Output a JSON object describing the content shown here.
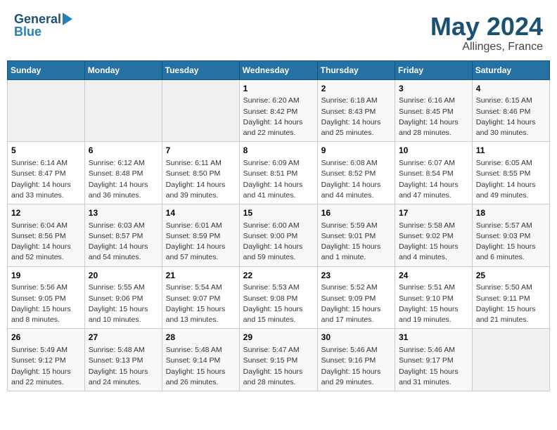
{
  "header": {
    "logo_line1": "General",
    "logo_line2": "Blue",
    "month": "May 2024",
    "location": "Allinges, France"
  },
  "days_of_week": [
    "Sunday",
    "Monday",
    "Tuesday",
    "Wednesday",
    "Thursday",
    "Friday",
    "Saturday"
  ],
  "weeks": [
    [
      {
        "day": "",
        "sunrise": "",
        "sunset": "",
        "daylight": ""
      },
      {
        "day": "",
        "sunrise": "",
        "sunset": "",
        "daylight": ""
      },
      {
        "day": "",
        "sunrise": "",
        "sunset": "",
        "daylight": ""
      },
      {
        "day": "1",
        "sunrise": "Sunrise: 6:20 AM",
        "sunset": "Sunset: 8:42 PM",
        "daylight": "Daylight: 14 hours and 22 minutes."
      },
      {
        "day": "2",
        "sunrise": "Sunrise: 6:18 AM",
        "sunset": "Sunset: 8:43 PM",
        "daylight": "Daylight: 14 hours and 25 minutes."
      },
      {
        "day": "3",
        "sunrise": "Sunrise: 6:16 AM",
        "sunset": "Sunset: 8:45 PM",
        "daylight": "Daylight: 14 hours and 28 minutes."
      },
      {
        "day": "4",
        "sunrise": "Sunrise: 6:15 AM",
        "sunset": "Sunset: 8:46 PM",
        "daylight": "Daylight: 14 hours and 30 minutes."
      }
    ],
    [
      {
        "day": "5",
        "sunrise": "Sunrise: 6:14 AM",
        "sunset": "Sunset: 8:47 PM",
        "daylight": "Daylight: 14 hours and 33 minutes."
      },
      {
        "day": "6",
        "sunrise": "Sunrise: 6:12 AM",
        "sunset": "Sunset: 8:48 PM",
        "daylight": "Daylight: 14 hours and 36 minutes."
      },
      {
        "day": "7",
        "sunrise": "Sunrise: 6:11 AM",
        "sunset": "Sunset: 8:50 PM",
        "daylight": "Daylight: 14 hours and 39 minutes."
      },
      {
        "day": "8",
        "sunrise": "Sunrise: 6:09 AM",
        "sunset": "Sunset: 8:51 PM",
        "daylight": "Daylight: 14 hours and 41 minutes."
      },
      {
        "day": "9",
        "sunrise": "Sunrise: 6:08 AM",
        "sunset": "Sunset: 8:52 PM",
        "daylight": "Daylight: 14 hours and 44 minutes."
      },
      {
        "day": "10",
        "sunrise": "Sunrise: 6:07 AM",
        "sunset": "Sunset: 8:54 PM",
        "daylight": "Daylight: 14 hours and 47 minutes."
      },
      {
        "day": "11",
        "sunrise": "Sunrise: 6:05 AM",
        "sunset": "Sunset: 8:55 PM",
        "daylight": "Daylight: 14 hours and 49 minutes."
      }
    ],
    [
      {
        "day": "12",
        "sunrise": "Sunrise: 6:04 AM",
        "sunset": "Sunset: 8:56 PM",
        "daylight": "Daylight: 14 hours and 52 minutes."
      },
      {
        "day": "13",
        "sunrise": "Sunrise: 6:03 AM",
        "sunset": "Sunset: 8:57 PM",
        "daylight": "Daylight: 14 hours and 54 minutes."
      },
      {
        "day": "14",
        "sunrise": "Sunrise: 6:01 AM",
        "sunset": "Sunset: 8:59 PM",
        "daylight": "Daylight: 14 hours and 57 minutes."
      },
      {
        "day": "15",
        "sunrise": "Sunrise: 6:00 AM",
        "sunset": "Sunset: 9:00 PM",
        "daylight": "Daylight: 14 hours and 59 minutes."
      },
      {
        "day": "16",
        "sunrise": "Sunrise: 5:59 AM",
        "sunset": "Sunset: 9:01 PM",
        "daylight": "Daylight: 15 hours and 1 minute."
      },
      {
        "day": "17",
        "sunrise": "Sunrise: 5:58 AM",
        "sunset": "Sunset: 9:02 PM",
        "daylight": "Daylight: 15 hours and 4 minutes."
      },
      {
        "day": "18",
        "sunrise": "Sunrise: 5:57 AM",
        "sunset": "Sunset: 9:03 PM",
        "daylight": "Daylight: 15 hours and 6 minutes."
      }
    ],
    [
      {
        "day": "19",
        "sunrise": "Sunrise: 5:56 AM",
        "sunset": "Sunset: 9:05 PM",
        "daylight": "Daylight: 15 hours and 8 minutes."
      },
      {
        "day": "20",
        "sunrise": "Sunrise: 5:55 AM",
        "sunset": "Sunset: 9:06 PM",
        "daylight": "Daylight: 15 hours and 10 minutes."
      },
      {
        "day": "21",
        "sunrise": "Sunrise: 5:54 AM",
        "sunset": "Sunset: 9:07 PM",
        "daylight": "Daylight: 15 hours and 13 minutes."
      },
      {
        "day": "22",
        "sunrise": "Sunrise: 5:53 AM",
        "sunset": "Sunset: 9:08 PM",
        "daylight": "Daylight: 15 hours and 15 minutes."
      },
      {
        "day": "23",
        "sunrise": "Sunrise: 5:52 AM",
        "sunset": "Sunset: 9:09 PM",
        "daylight": "Daylight: 15 hours and 17 minutes."
      },
      {
        "day": "24",
        "sunrise": "Sunrise: 5:51 AM",
        "sunset": "Sunset: 9:10 PM",
        "daylight": "Daylight: 15 hours and 19 minutes."
      },
      {
        "day": "25",
        "sunrise": "Sunrise: 5:50 AM",
        "sunset": "Sunset: 9:11 PM",
        "daylight": "Daylight: 15 hours and 21 minutes."
      }
    ],
    [
      {
        "day": "26",
        "sunrise": "Sunrise: 5:49 AM",
        "sunset": "Sunset: 9:12 PM",
        "daylight": "Daylight: 15 hours and 22 minutes."
      },
      {
        "day": "27",
        "sunrise": "Sunrise: 5:48 AM",
        "sunset": "Sunset: 9:13 PM",
        "daylight": "Daylight: 15 hours and 24 minutes."
      },
      {
        "day": "28",
        "sunrise": "Sunrise: 5:48 AM",
        "sunset": "Sunset: 9:14 PM",
        "daylight": "Daylight: 15 hours and 26 minutes."
      },
      {
        "day": "29",
        "sunrise": "Sunrise: 5:47 AM",
        "sunset": "Sunset: 9:15 PM",
        "daylight": "Daylight: 15 hours and 28 minutes."
      },
      {
        "day": "30",
        "sunrise": "Sunrise: 5:46 AM",
        "sunset": "Sunset: 9:16 PM",
        "daylight": "Daylight: 15 hours and 29 minutes."
      },
      {
        "day": "31",
        "sunrise": "Sunrise: 5:46 AM",
        "sunset": "Sunset: 9:17 PM",
        "daylight": "Daylight: 15 hours and 31 minutes."
      },
      {
        "day": "",
        "sunrise": "",
        "sunset": "",
        "daylight": ""
      }
    ]
  ]
}
